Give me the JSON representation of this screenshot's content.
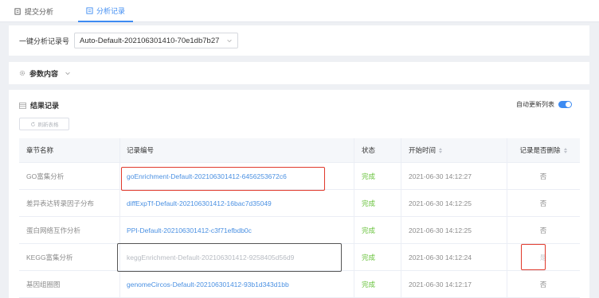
{
  "tabs": [
    {
      "label": "提交分析",
      "icon": "submit-doc-icon",
      "active": false
    },
    {
      "label": "分析记录",
      "icon": "record-list-icon",
      "active": true
    }
  ],
  "selector": {
    "label": "一键分析记录号",
    "value": "Auto-Default-202106301410-70e1db7b27"
  },
  "params": {
    "label": "参数内容"
  },
  "results": {
    "title": "结果记录",
    "auto_refresh_label": "自动更新列表",
    "auto_refresh_on": true,
    "refresh_button": "刷新表格",
    "columns": [
      "章节名称",
      "记录编号",
      "状态",
      "开始时间",
      "记录是否删除"
    ],
    "rows": [
      {
        "chapter": "GO富集分析",
        "record": "goEnrichment-Default-202106301412-6456253672c6",
        "status": "完成",
        "start": "2021-06-30 14:12:27",
        "deleted": "否"
      },
      {
        "chapter": "差异表达转录因子分布",
        "record": "diffExpTf-Default-202106301412-16bac7d35049",
        "status": "完成",
        "start": "2021-06-30 14:12:25",
        "deleted": "否"
      },
      {
        "chapter": "蛋白网络互作分析",
        "record": "PPI-Default-202106301412-c3f71efbdb0c",
        "status": "完成",
        "start": "2021-06-30 14:12:25",
        "deleted": "否"
      },
      {
        "chapter": "KEGG富集分析",
        "record": "keggEnrichment-Default-202106301412-9258405d56d9",
        "status": "完成",
        "start": "2021-06-30 14:12:24",
        "deleted": "是"
      },
      {
        "chapter": "基因组圈图",
        "record": "genomeCircos-Default-202106301412-93b1d343d1bb",
        "status": "完成",
        "start": "2021-06-30 14:12:17",
        "deleted": "否"
      }
    ]
  },
  "colors": {
    "accent": "#3d8bf2",
    "link": "#4a90e2",
    "success": "#67c23a",
    "highlight_red": "#e0392b"
  }
}
